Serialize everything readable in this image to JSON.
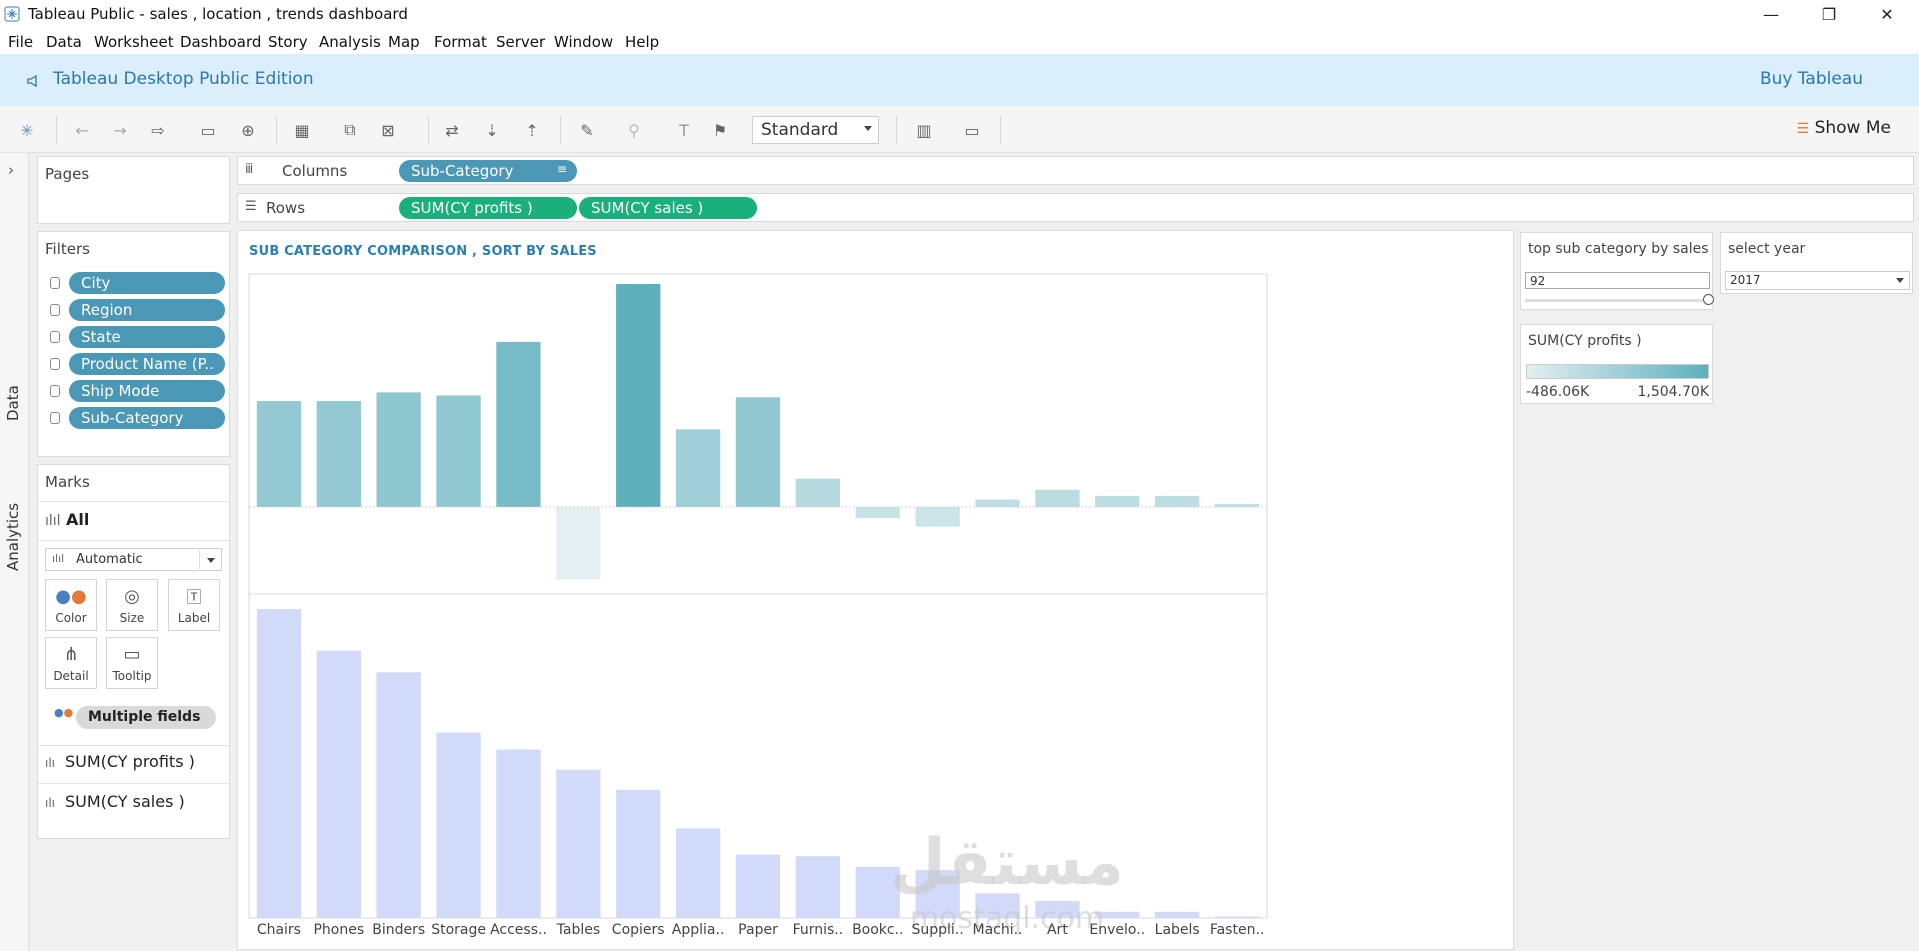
{
  "window": {
    "title": "Tableau Public - sales , location , trends dashboard",
    "controls": {
      "minimize": "—",
      "restore": "❐",
      "close": "✕"
    }
  },
  "menu": [
    "File",
    "Data",
    "Worksheet",
    "Dashboard",
    "Story",
    "Analysis",
    "Map",
    "Format",
    "Server",
    "Window",
    "Help"
  ],
  "banner": {
    "edition": "Tableau Desktop Public Edition",
    "buy": "Buy Tableau"
  },
  "toolbar": {
    "fit_value": "Standard",
    "show_me": "Show Me",
    "icons": [
      "tableau-logo-icon",
      "undo-icon",
      "redo-icon",
      "replay-icon",
      "save-icon",
      "add-datasource-icon",
      "new-worksheet-icon",
      "duplicate-icon",
      "clear-icon",
      "swap-icon",
      "sort-ascending-icon",
      "sort-descending-icon",
      "highlight-icon",
      "group-icon",
      "text-label-icon",
      "pin-icon",
      "device-preview-icon",
      "presentation-icon"
    ]
  },
  "left_tabs": {
    "data": "Data",
    "analytics": "Analytics",
    "toggle": "›"
  },
  "pages": {
    "title": "Pages"
  },
  "filters": {
    "title": "Filters",
    "items": [
      "City",
      "Region",
      "State",
      "Product Name (P..",
      "Ship Mode",
      "Sub-Category"
    ]
  },
  "marks": {
    "title": "Marks",
    "all": "All",
    "type": "Automatic",
    "buttons": [
      "Color",
      "Size",
      "Label",
      "Detail",
      "Tooltip"
    ],
    "multiple": "Multiple fields",
    "measures": [
      "SUM(CY profits )",
      "SUM(CY sales )"
    ]
  },
  "shelves": {
    "columns_label": "Columns",
    "rows_label": "Rows",
    "columns_pills": [
      "Sub-Category"
    ],
    "rows_pills": [
      "SUM(CY profits )",
      "SUM(CY sales )"
    ]
  },
  "parameters": {
    "top_label": "top sub category by sales",
    "top_value": "92",
    "top_fraction": 1.0,
    "year_label": "select year",
    "year_value": "2017"
  },
  "legend": {
    "title": "SUM(CY profits )",
    "min": "-486.06K",
    "max": "1,504.70K",
    "color_low": "#e3eff1",
    "color_high": "#5eb0bd"
  },
  "chart_data": {
    "type": "bar",
    "title": "SUB CATEGORY COMPARISON , SORT BY SALES",
    "categories": [
      "Chairs",
      "Phones",
      "Binders",
      "Storage",
      "Access..",
      "Tables",
      "Copiers",
      "Applia..",
      "Paper",
      "Furnis..",
      "Bookc..",
      "Suppli..",
      "Machi..",
      "Art",
      "Envelo..",
      "Labels",
      "Fasten.."
    ],
    "series": [
      {
        "name": "SUM(CY profits )",
        "values": [
          860,
          860,
          930,
          905,
          1340,
          -590,
          1810,
          630,
          890,
          230,
          -90,
          -160,
          60,
          140,
          90,
          90,
          25
        ],
        "color": "#5eb0bd"
      },
      {
        "name": "SUM(CY sales )",
        "values": [
          1000,
          865,
          795,
          600,
          545,
          480,
          415,
          290,
          205,
          200,
          165,
          155,
          80,
          55,
          20,
          20,
          5
        ],
        "color": "#d1daf8"
      }
    ],
    "xlabel": "",
    "ylabel": "",
    "grid": false,
    "watermark": {
      "arabic": "مستقل",
      "latin": "mostaql.com"
    }
  }
}
